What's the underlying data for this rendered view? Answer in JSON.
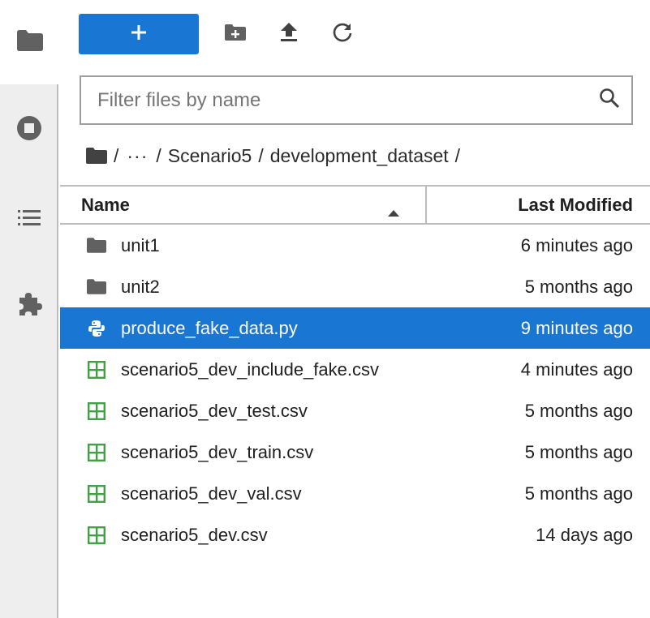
{
  "sidebar": {
    "tabs": [
      {
        "icon": "folder-icon"
      },
      {
        "icon": "stop-circle-icon"
      },
      {
        "icon": "list-icon"
      },
      {
        "icon": "puzzle-icon"
      }
    ]
  },
  "toolbar": {
    "new_label": "+",
    "new_folder_icon": "new-folder-icon",
    "upload_icon": "upload-icon",
    "refresh_icon": "refresh-icon"
  },
  "filter": {
    "placeholder": "Filter files by name",
    "value": ""
  },
  "breadcrumb": {
    "root_sep": "/",
    "ellipsis": "···",
    "sep1": "/",
    "item1": "Scenario5",
    "sep2": "/",
    "item2": "development_dataset",
    "sep3": "/"
  },
  "columns": {
    "name": "Name",
    "modified": "Last Modified"
  },
  "files": [
    {
      "type": "folder",
      "name": "unit1",
      "modified": "6 minutes ago",
      "selected": false
    },
    {
      "type": "folder",
      "name": "unit2",
      "modified": "5 months ago",
      "selected": false
    },
    {
      "type": "python",
      "name": "produce_fake_data.py",
      "modified": "9 minutes ago",
      "selected": true
    },
    {
      "type": "csv",
      "name": "scenario5_dev_include_fake.csv",
      "modified": "4 minutes ago",
      "selected": false
    },
    {
      "type": "csv",
      "name": "scenario5_dev_test.csv",
      "modified": "5 months ago",
      "selected": false
    },
    {
      "type": "csv",
      "name": "scenario5_dev_train.csv",
      "modified": "5 months ago",
      "selected": false
    },
    {
      "type": "csv",
      "name": "scenario5_dev_val.csv",
      "modified": "5 months ago",
      "selected": false
    },
    {
      "type": "csv",
      "name": "scenario5_dev.csv",
      "modified": "14 days ago",
      "selected": false
    }
  ],
  "colors": {
    "accent": "#1976d2",
    "csv_icon": "#43a047",
    "folder_icon": "#616161"
  }
}
